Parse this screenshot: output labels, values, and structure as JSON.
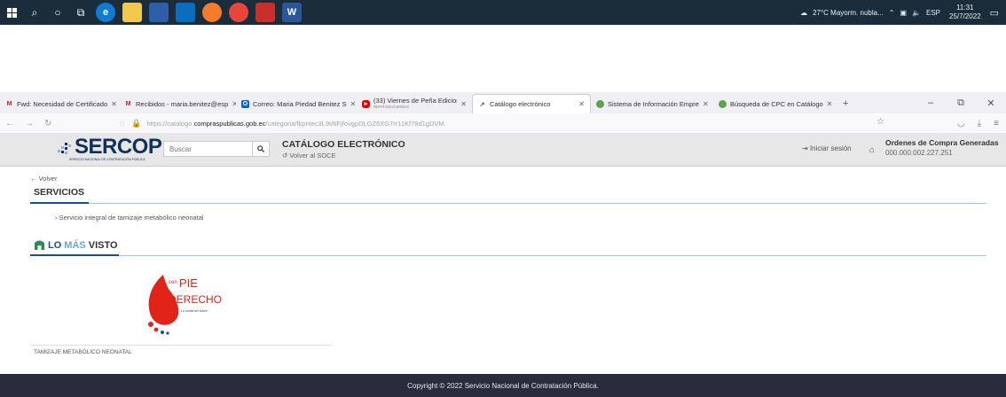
{
  "taskbar": {
    "weather": "27°C Mayorm. nubla...",
    "lang": "ESP",
    "time": "11:31",
    "date": "25/7/2022"
  },
  "tabs": [
    {
      "label": "Fwd: Necesidad de Certificado",
      "favicon": "gmail-icon",
      "color": "#c5221f"
    },
    {
      "label": "Recibidos - maria.benitez@esp",
      "favicon": "gmail-icon",
      "color": "#c5221f"
    },
    {
      "label": "Correo: Maria Piedad Benitez S",
      "favicon": "outlook-icon",
      "color": "#0a64d6"
    },
    {
      "label": "(33) Viernes de Peña Edicion 67",
      "favicon": "youtube-icon",
      "color": "#e00000"
    },
    {
      "label": "Catálogo electrónico",
      "favicon": "catalog-icon",
      "color": "#555555",
      "active": true
    },
    {
      "label": "Sistema de Información Empre",
      "favicon": "globe-icon",
      "color": "#5aa34a"
    },
    {
      "label": "Búsqueda de CPC en Catálogo",
      "favicon": "globe-icon",
      "color": "#5aa34a"
    }
  ],
  "youtube_sub": "REPRODUCIENDO",
  "url": {
    "prefix": "https://catalogo.",
    "domain": "compraspublicas.gob.ec",
    "rest": "/categoria/fkpntec3L9t/6FjfovgpDLGZ6XG7rr11Kf78d1gDVM."
  },
  "header": {
    "logo": "SERCOP",
    "logo_sub": "SERVICIO NACIONAL DE CONTRATACIÓN PÚBLICA",
    "search_placeholder": "Buscar",
    "catalog_title": "CATÁLOGO ELECTRÓNICO",
    "back_soce": "Volver al SOCE",
    "login": "Iniciar sesión",
    "orders_title": "Ordenes de Compra Generadas",
    "orders_number": "000.000.002.227.251"
  },
  "main": {
    "back": "Volver",
    "section_title": "SERVICIOS",
    "service_item": "Servicio integral de tamizaje metabólico neonatal",
    "most_viewed": {
      "lo": "LO",
      "mas": "MÁS",
      "visto": "VISTO"
    },
    "product": {
      "logo_con": "con",
      "logo_pie": "PIE",
      "logo_derecho": "DERECHO",
      "logo_tagline": "La huella del futuro",
      "name": "TAMIZAJE METABÓLICO NEONATAL"
    }
  },
  "footer": {
    "copyright": "Copyright © 2022 Servicio Nacional de Contratación Pública."
  }
}
